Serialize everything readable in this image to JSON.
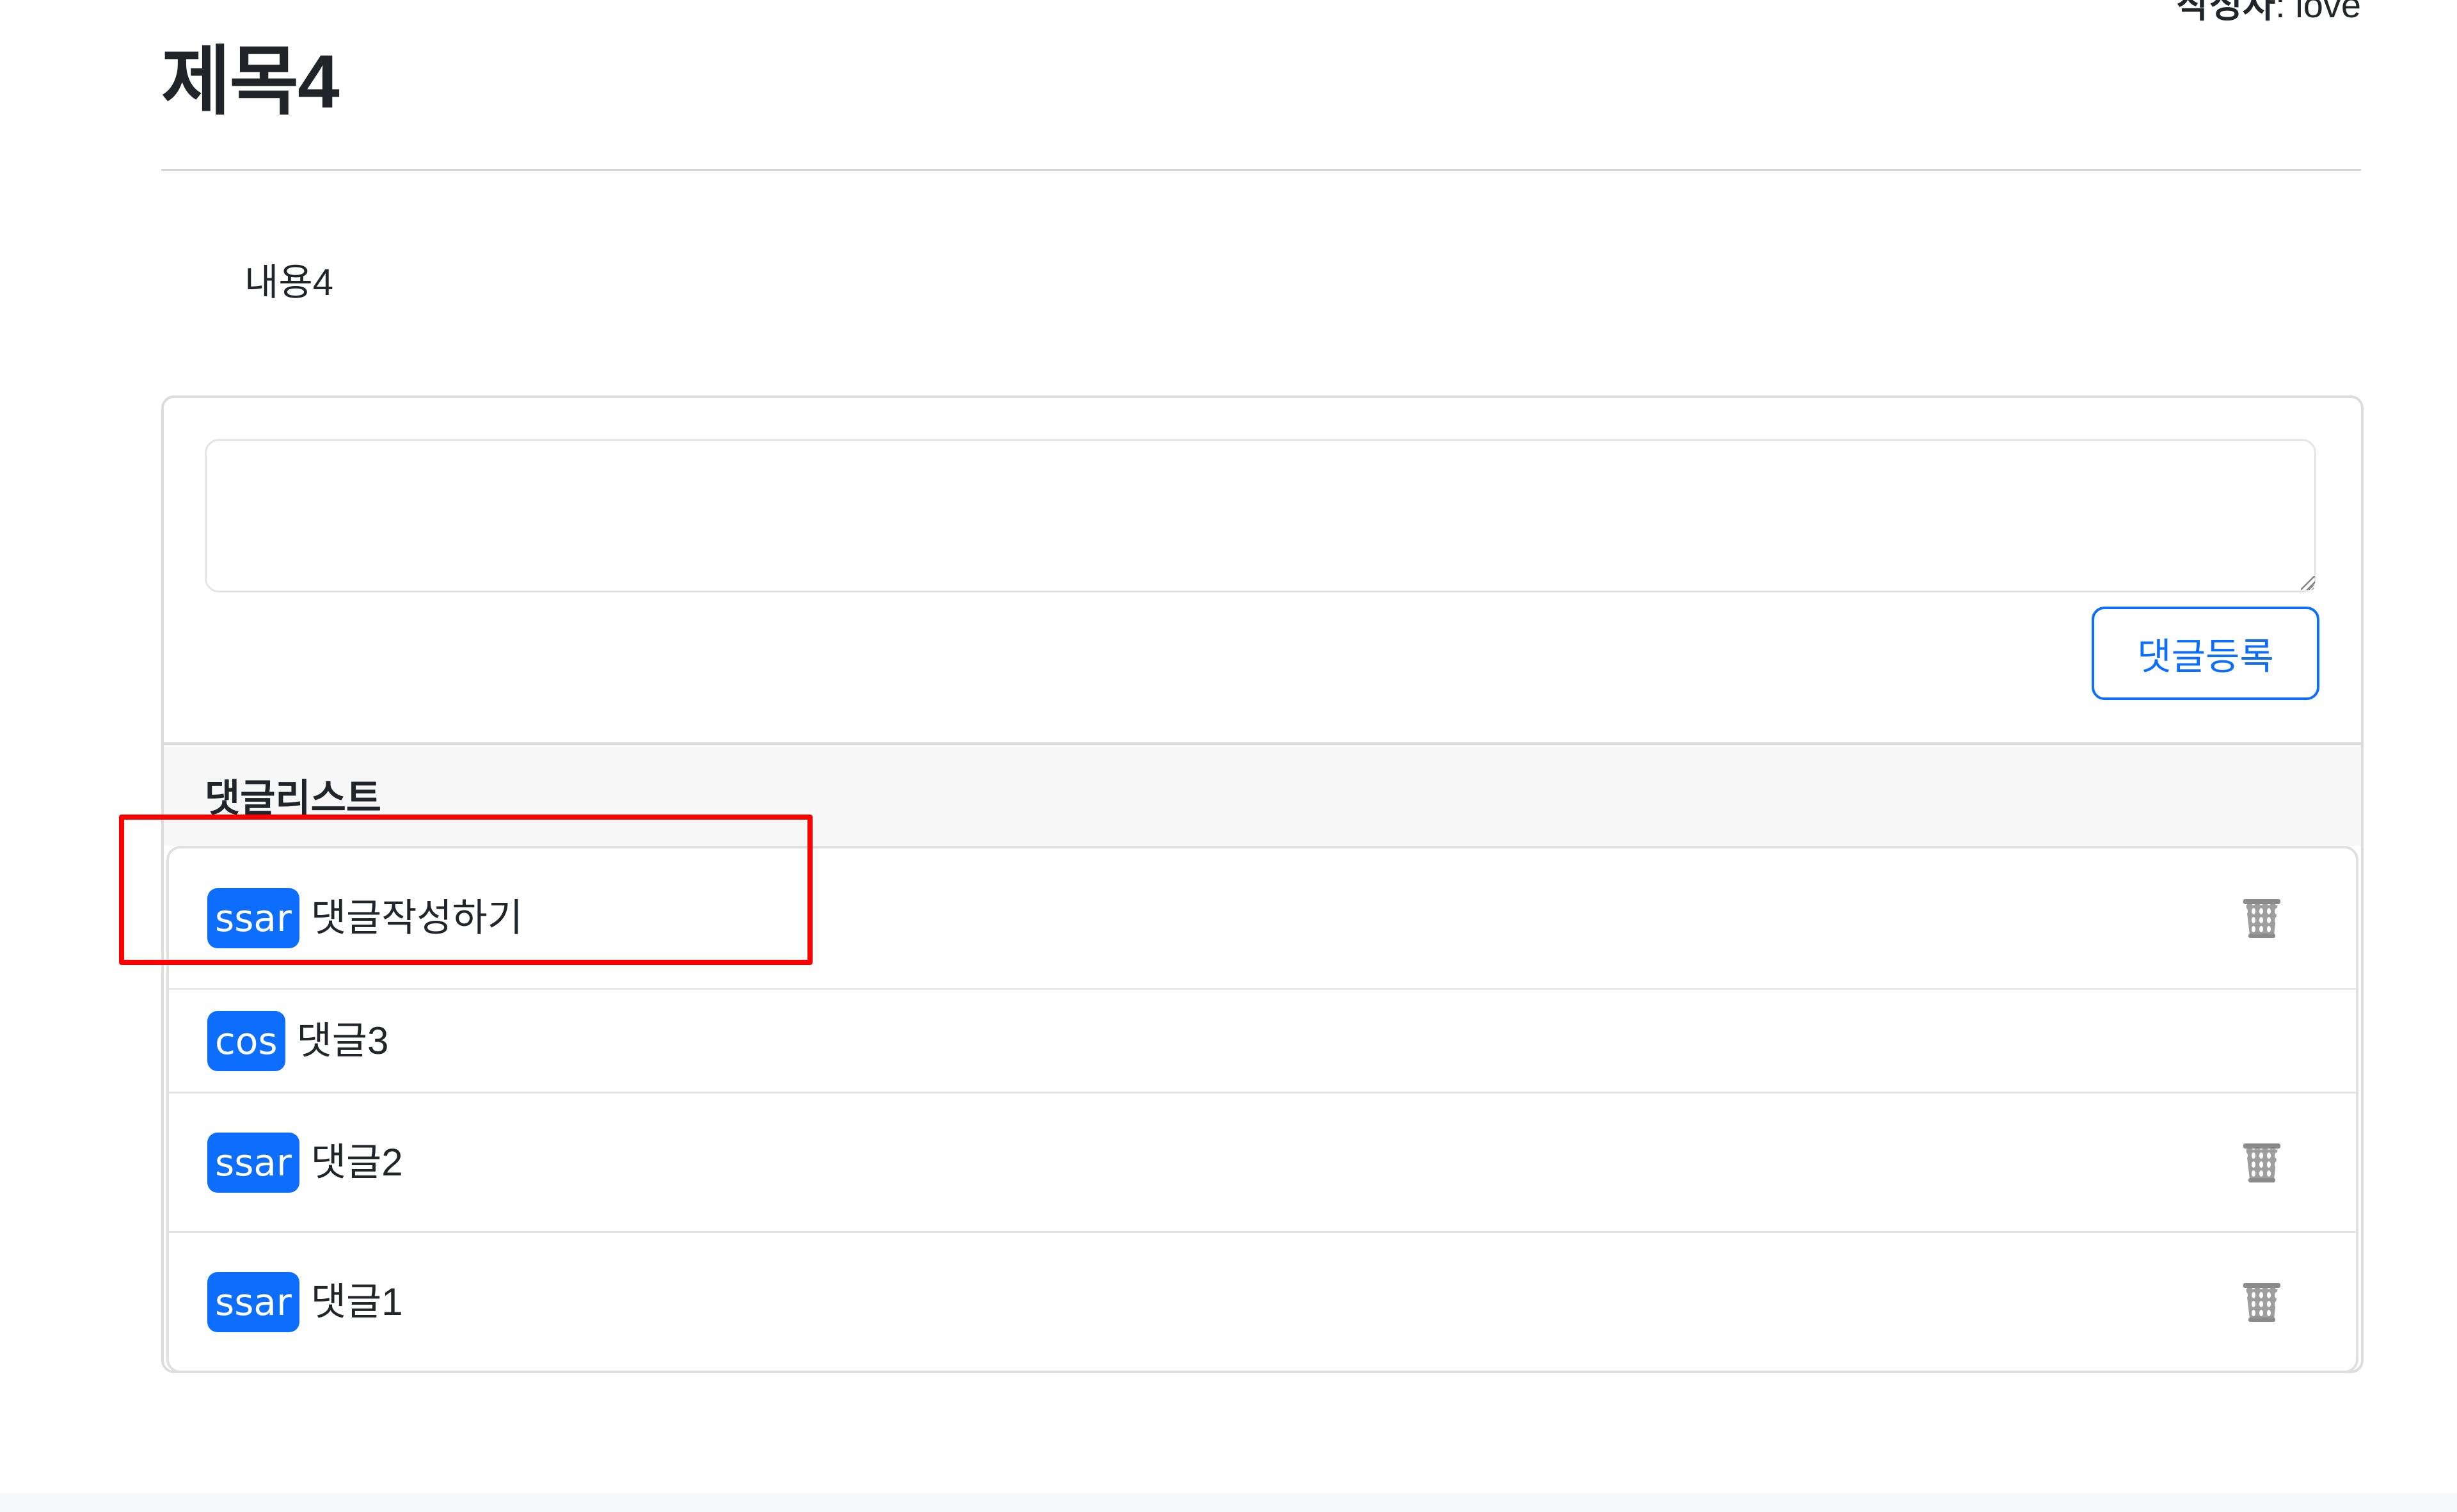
{
  "post": {
    "author_label": "작성자",
    "author_separator": ": ",
    "author_name": "love",
    "title": "제목4",
    "content": "내용4"
  },
  "reply_form": {
    "textarea_value": "",
    "textarea_placeholder": "",
    "submit_label": "댓글등록"
  },
  "reply_list": {
    "header": "댓글리스트",
    "items": [
      {
        "username": "ssar",
        "content": "댓글작성하기",
        "deletable": true,
        "delete_icon": "trash-icon"
      },
      {
        "username": "cos",
        "content": "댓글3",
        "deletable": false
      },
      {
        "username": "ssar",
        "content": "댓글2",
        "deletable": true,
        "delete_icon": "trash-icon"
      },
      {
        "username": "ssar",
        "content": "댓글1",
        "deletable": true,
        "delete_icon": "trash-icon"
      }
    ]
  },
  "annotation": {
    "highlight_color": "#ff0000",
    "highlighted_item_index": 0
  },
  "colors": {
    "primary": "#0d6efd",
    "text": "#212529",
    "header_bg": "#f7f7f7"
  }
}
